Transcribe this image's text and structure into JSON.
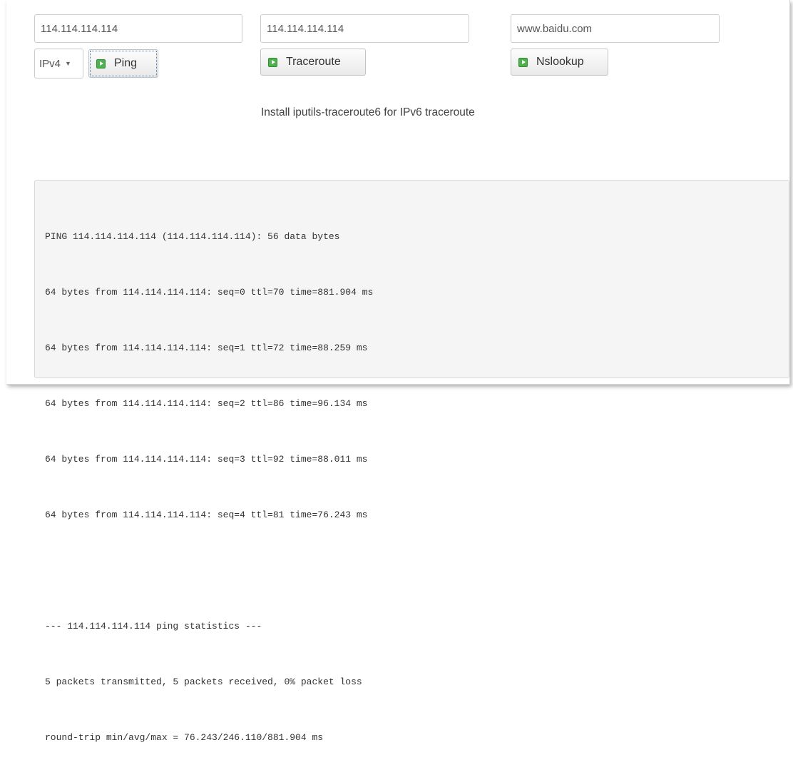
{
  "ping": {
    "host_value": "114.114.114.114",
    "protocol_selected": "IPv4",
    "button_label": "Ping"
  },
  "traceroute": {
    "host_value": "114.114.114.114",
    "button_label": "Traceroute",
    "note": "Install iputils-traceroute6 for IPv6 traceroute"
  },
  "nslookup": {
    "host_value": "www.baidu.com",
    "button_label": "Nslookup"
  },
  "output": {
    "lines": [
      "PING 114.114.114.114 (114.114.114.114): 56 data bytes",
      "64 bytes from 114.114.114.114: seq=0 ttl=70 time=881.904 ms",
      "64 bytes from 114.114.114.114: seq=1 ttl=72 time=88.259 ms",
      "64 bytes from 114.114.114.114: seq=2 ttl=86 time=96.134 ms",
      "64 bytes from 114.114.114.114: seq=3 ttl=92 time=88.011 ms",
      "64 bytes from 114.114.114.114: seq=4 ttl=81 time=76.243 ms",
      "",
      "--- 114.114.114.114 ping statistics ---",
      "5 packets transmitted, 5 packets received, 0% packet loss",
      "round-trip min/avg/max = 76.243/246.110/881.904 ms"
    ]
  },
  "icons": {
    "button_icon": "play-icon",
    "select_arrow": "chevron-down-icon"
  },
  "colors": {
    "icon_green": "#4db24d",
    "output_background": "#f5f5f5"
  }
}
